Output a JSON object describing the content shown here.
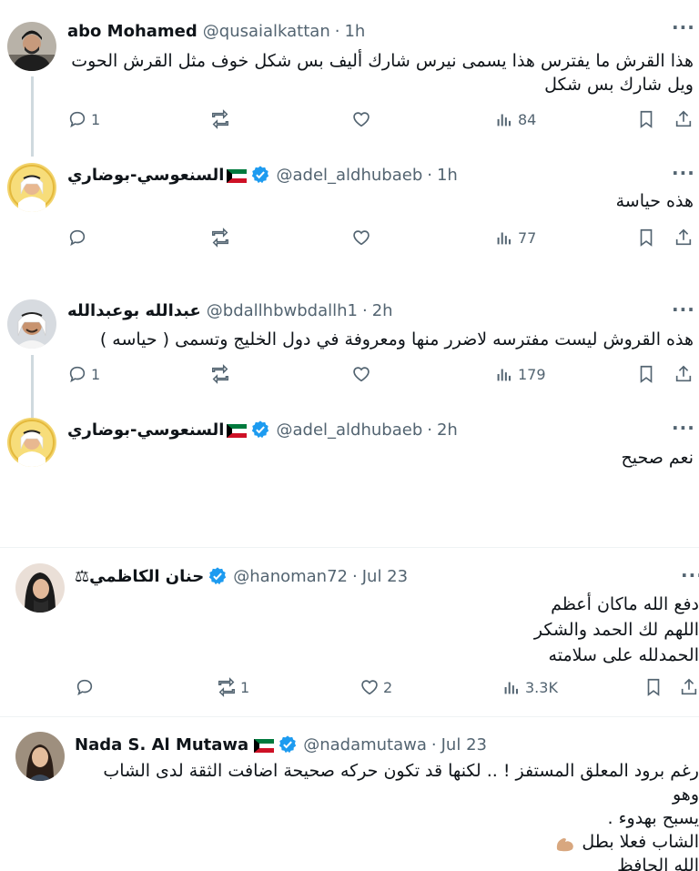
{
  "colors": {
    "text": "#0f1419",
    "secondary": "#536471",
    "verified": "#1d9bf0",
    "thread_line": "#cfd9de"
  },
  "tweets": [
    {
      "name": "abo Mohamed",
      "handle": "@qusaialkattan",
      "time": "1h",
      "lines": [
        "هذا القرش ما يفترس هذا يسمى نيرس شارك أليف بس شكل خوف مثل القرش الحوت",
        "ويل شارك بس شكل"
      ],
      "replies": "1",
      "retweets": "",
      "likes": "",
      "views": "84"
    },
    {
      "name": "السنعوسي-بوضاري",
      "handle": "@adel_aldhubaeb",
      "time": "1h",
      "lines": [
        "هذه حياسة"
      ],
      "replies": "",
      "retweets": "",
      "likes": "",
      "views": "77"
    },
    {
      "name": "عبدالله بوعبدالله",
      "handle": "@bdallhbwbdallh1",
      "time": "2h",
      "lines": [
        "هذه القروش ليست مفترسه لاضرر منها ومعروفة في دول الخليج وتسمى ( حياسه )"
      ],
      "replies": "1",
      "retweets": "",
      "likes": "",
      "views": "179"
    },
    {
      "name": "السنعوسي-بوضاري",
      "handle": "@adel_aldhubaeb",
      "time": "2h",
      "lines": [
        "نعم صحيح"
      ]
    },
    {
      "name": "حنان الكاظمي",
      "handle": "@hanoman72",
      "time": "Jul 23",
      "lines": [
        "دفع الله ماكان أعظم",
        "اللهم لك الحمد والشكر",
        "الحمدلله على سلامته"
      ],
      "replies": "",
      "retweets": "1",
      "likes": "2",
      "views": "3.3K"
    },
    {
      "name": "Nada S. Al Mutawa",
      "handle": "@nadamutawa",
      "time": "Jul 23",
      "lines": [
        "رغم برود المعلق المستفز ! .. لكنها قد تكون حركه صحيحة اضافت الثقة لدى الشاب وهو",
        "يسبح بهدوء .",
        "الشاب فعلا بطل",
        "الله الحافظ"
      ]
    }
  ]
}
